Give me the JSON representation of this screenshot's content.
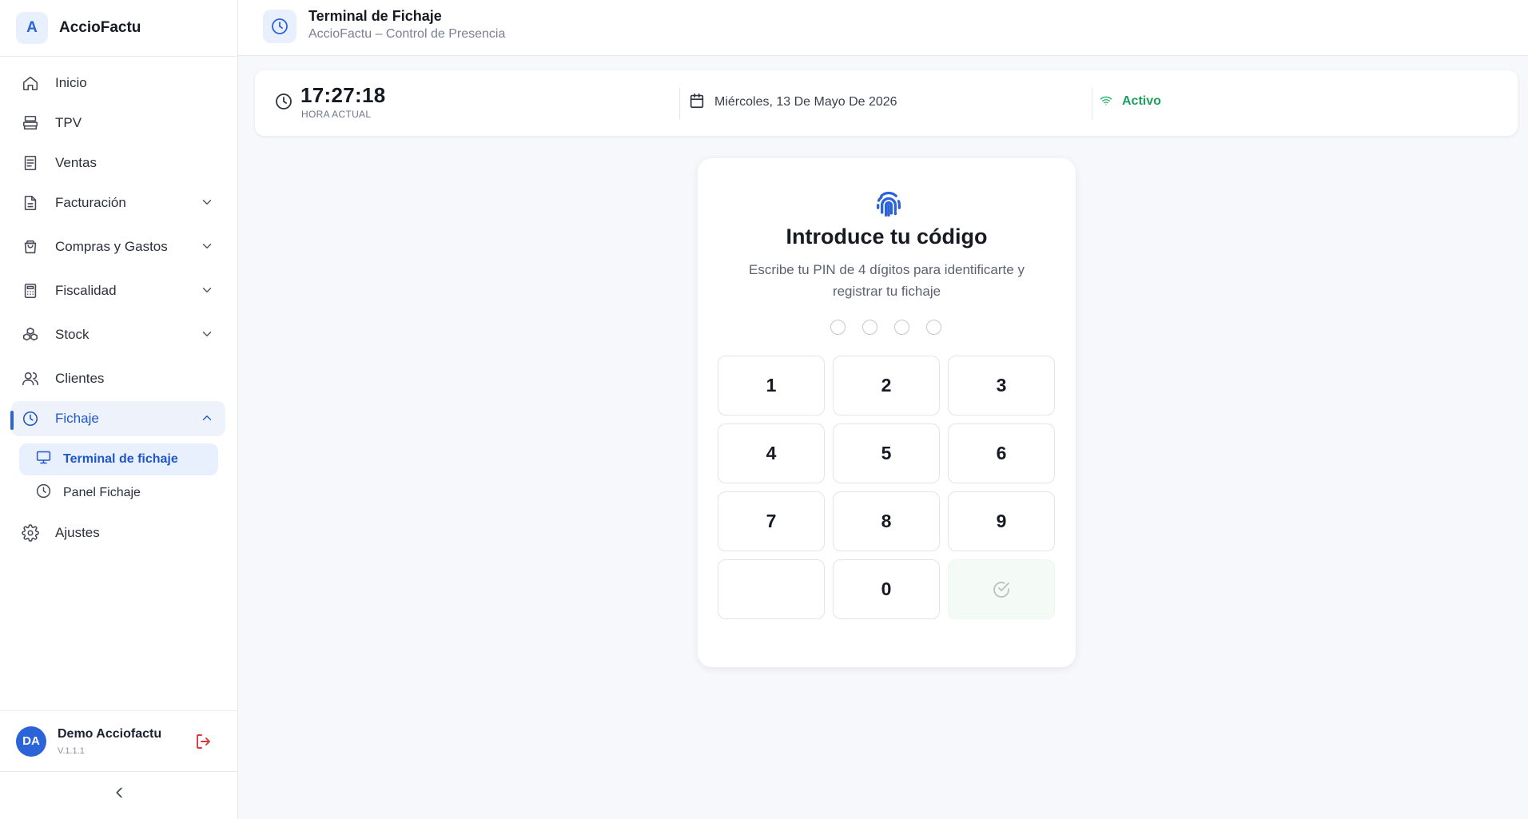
{
  "brand": {
    "initial": "A",
    "name": "AccioFactu"
  },
  "sidebar": {
    "items": [
      {
        "label": "Inicio"
      },
      {
        "label": "TPV"
      },
      {
        "label": "Ventas"
      },
      {
        "label": "Facturación"
      },
      {
        "label": "Compras y Gastos"
      },
      {
        "label": "Fiscalidad"
      },
      {
        "label": "Stock"
      },
      {
        "label": "Clientes"
      },
      {
        "label": "Fichaje"
      },
      {
        "label": "Ajustes"
      }
    ],
    "subitems": [
      {
        "label": "Terminal de fichaje"
      },
      {
        "label": "Panel Fichaje"
      }
    ]
  },
  "user": {
    "initials": "DA",
    "name": "Demo Acciofactu",
    "version": "V.1.1.1"
  },
  "header": {
    "title": "Terminal de Fichaje",
    "subtitle": "AccioFactu – Control de Presencia"
  },
  "status": {
    "time": "17:27:18",
    "time_label": "HORA ACTUAL",
    "date": "Miércoles, 13 De Mayo De 2026",
    "connection": "Activo"
  },
  "pin": {
    "title": "Introduce tu código",
    "description": "Escribe tu PIN de 4 dígitos para identificarte y registrar tu fichaje",
    "keys": [
      "1",
      "2",
      "3",
      "4",
      "5",
      "6",
      "7",
      "8",
      "9",
      "",
      "0"
    ]
  },
  "colors": {
    "accent": "#2d63d8",
    "active_green": "#1e9e5e",
    "logout_red": "#d83a3a"
  }
}
